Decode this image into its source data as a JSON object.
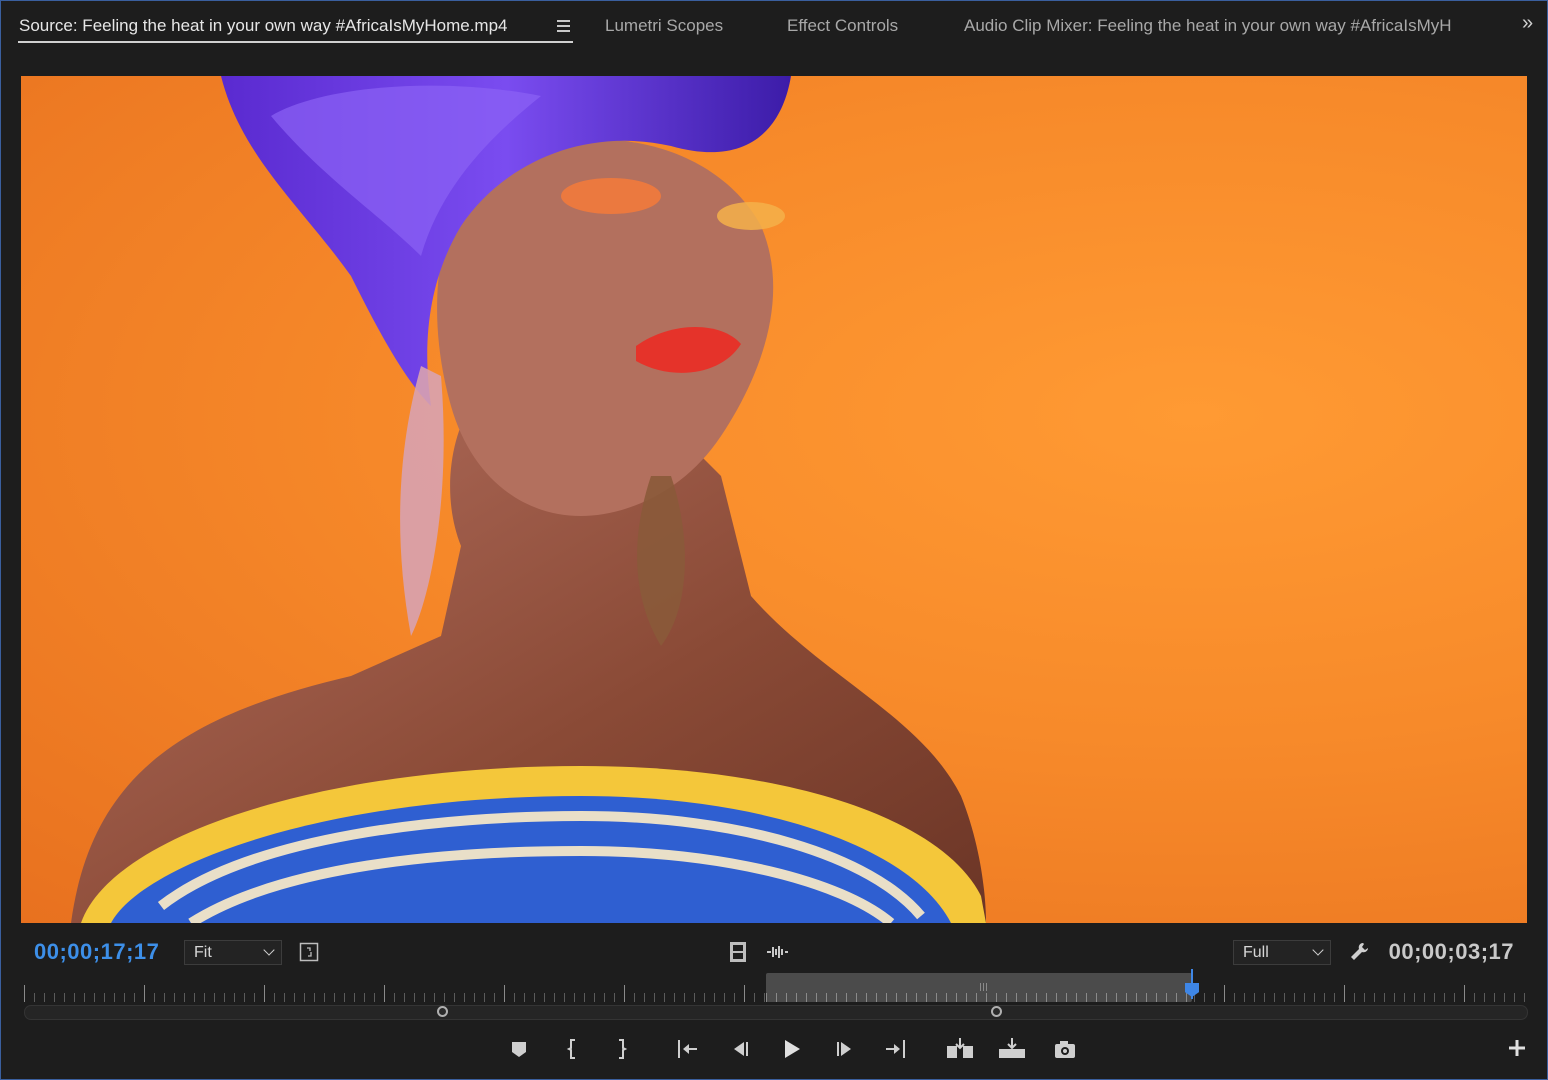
{
  "tabs": {
    "source": "Source: Feeling the heat in your own way  #AfricaIsMyHome.mp4",
    "lumetri": "Lumetri Scopes",
    "effects": "Effect Controls",
    "audio": "Audio Clip Mixer: Feeling the heat in your own way  #AfricaIsMyH"
  },
  "controls": {
    "timecode_current": "00;00;17;17",
    "zoom_value": "Fit",
    "resolution_value": "Full",
    "timecode_duration": "00;00;03;17"
  },
  "icons": {
    "panel_menu": "hamburger-icon",
    "overflow": "double-chevron-right-icon",
    "safe_margins": "safe-margins-icon",
    "drag_video": "film-strip-icon",
    "drag_audio": "audio-waveform-icon",
    "settings": "wrench-icon",
    "transport": [
      "marker-icon",
      "mark-in-icon",
      "mark-out-icon",
      "go-to-in-icon",
      "step-back-icon",
      "play-icon",
      "step-forward-icon",
      "go-to-out-icon",
      "insert-icon",
      "overwrite-icon",
      "export-frame-icon"
    ],
    "add": "plus-icon"
  },
  "colors": {
    "accent": "#3e86e6",
    "border": "#3a5f9e",
    "background": "#1d1d1d"
  }
}
